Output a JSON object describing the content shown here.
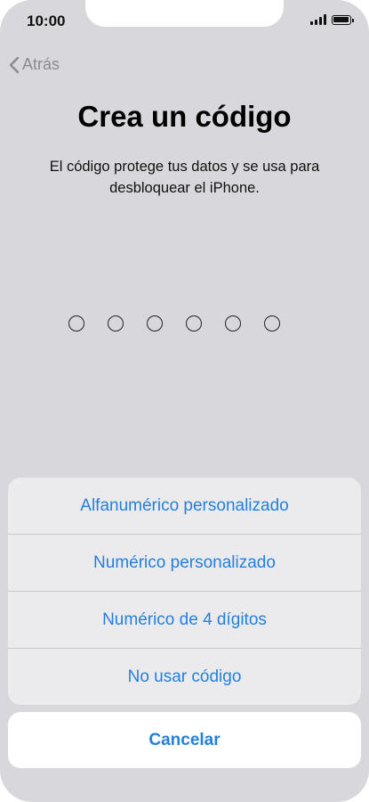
{
  "status_bar": {
    "time": "10:00"
  },
  "nav": {
    "back_label": "Atrás"
  },
  "page": {
    "title": "Crea un código",
    "subtitle": "El código protege tus datos y se usa para desbloquear el iPhone."
  },
  "passcode": {
    "digits": 6,
    "entered": 0
  },
  "action_sheet": {
    "options": [
      {
        "label": "Alfanumérico personalizado"
      },
      {
        "label": "Numérico personalizado"
      },
      {
        "label": "Numérico de 4 dígitos"
      },
      {
        "label": "No usar código"
      }
    ],
    "cancel_label": "Cancelar"
  },
  "colors": {
    "accent": "#2480dc",
    "background": "#d8d7db",
    "sheet": "#ebebee"
  }
}
